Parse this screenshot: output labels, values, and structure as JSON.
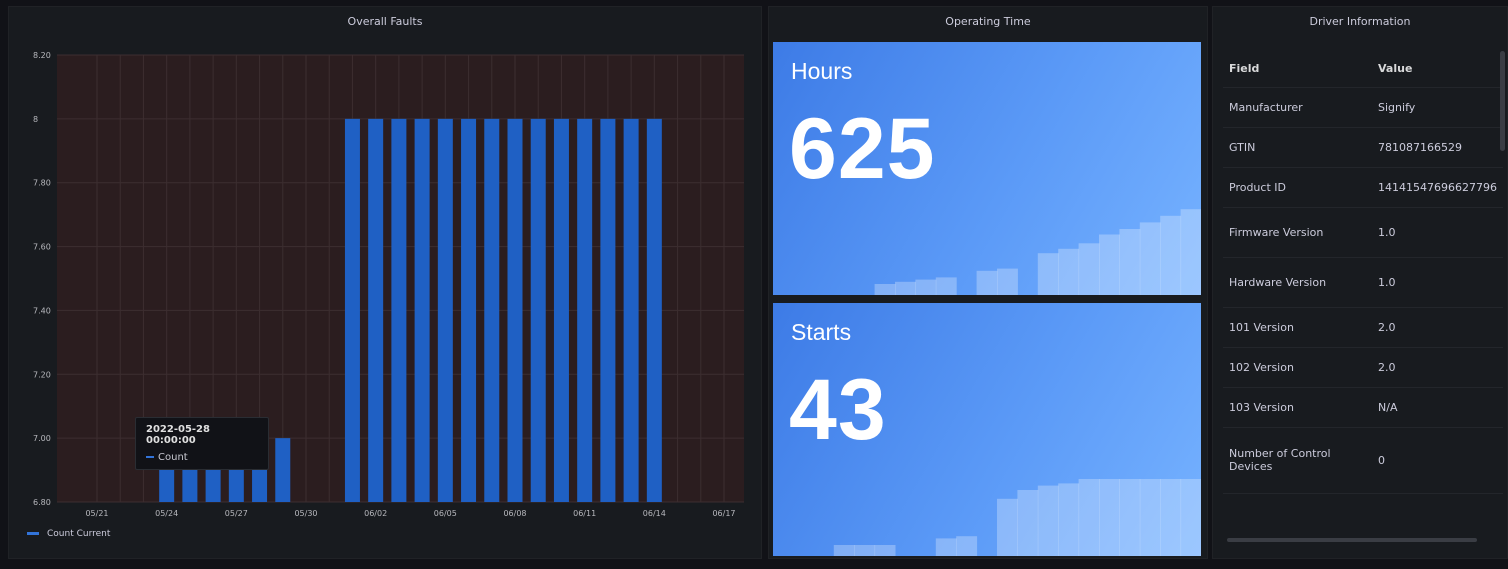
{
  "faults_panel": {
    "title": "Overall Faults",
    "legend": "Count Current",
    "tooltip": {
      "title": "2022-05-28 00:00:00",
      "series": "Count"
    }
  },
  "optime_panel": {
    "title": "Operating Time",
    "hours": {
      "label": "Hours",
      "value": "625"
    },
    "starts": {
      "label": "Starts",
      "value": "43"
    }
  },
  "driver_panel": {
    "title": "Driver Information",
    "headers": [
      "Field",
      "Value"
    ],
    "rows": [
      [
        "Manufacturer",
        "Signify"
      ],
      [
        "GTIN",
        "781087166529"
      ],
      [
        "Product ID",
        "14141547696627796"
      ],
      [
        "Firmware Version",
        "1.0"
      ],
      [
        "Hardware Version",
        "1.0"
      ],
      [
        "101 Version",
        "2.0"
      ],
      [
        "102 Version",
        "2.0"
      ],
      [
        "103 Version",
        "N/A"
      ],
      [
        "Number of Control Devices",
        "0"
      ]
    ]
  },
  "colors": {
    "bar": "#1f60c4",
    "stat_bg": "#5b9af7",
    "plot_bg": "#2b1d1f",
    "grid": "#3c2e30"
  },
  "chart_data": {
    "type": "bar",
    "title": "Overall Faults",
    "xlabel": "",
    "ylabel": "",
    "ylim": [
      6.8,
      8.2
    ],
    "yticks": [
      "8.20",
      "8",
      "7.80",
      "7.60",
      "7.40",
      "7.20",
      "7.00",
      "6.80"
    ],
    "xticks": [
      "05/21",
      "05/24",
      "05/27",
      "05/30",
      "06/02",
      "06/05",
      "06/08",
      "06/11",
      "06/14",
      "06/17"
    ],
    "categories": [
      "05/21",
      "05/22",
      "05/23",
      "05/24",
      "05/25",
      "05/26",
      "05/27",
      "05/28",
      "05/29",
      "05/30",
      "05/31",
      "06/01",
      "06/02",
      "06/03",
      "06/04",
      "06/05",
      "06/06",
      "06/07",
      "06/08",
      "06/09",
      "06/10",
      "06/11",
      "06/12",
      "06/13",
      "06/14",
      "06/15",
      "06/16",
      "06/17"
    ],
    "series": [
      {
        "name": "Count Current",
        "values": [
          null,
          null,
          null,
          7,
          7,
          7,
          7,
          7,
          7,
          null,
          null,
          8,
          8,
          8,
          8,
          8,
          8,
          8,
          8,
          8,
          8,
          8,
          8,
          8,
          8,
          null,
          null,
          null
        ]
      }
    ],
    "legend": "bottom-left",
    "grid": true
  },
  "sparklines": {
    "hours": [
      0,
      0,
      0,
      0,
      0.1,
      0.12,
      0.14,
      0.16,
      0,
      0.22,
      0.24,
      0,
      0.38,
      0.42,
      0.47,
      0.55,
      0.6,
      0.66,
      0.72,
      0.78
    ],
    "starts": [
      0,
      0,
      0.1,
      0.1,
      0.1,
      0,
      0,
      0.16,
      0.18,
      0,
      0.52,
      0.6,
      0.64,
      0.66,
      0.7,
      0.7,
      0.7,
      0.7,
      0.7,
      0.7
    ]
  }
}
